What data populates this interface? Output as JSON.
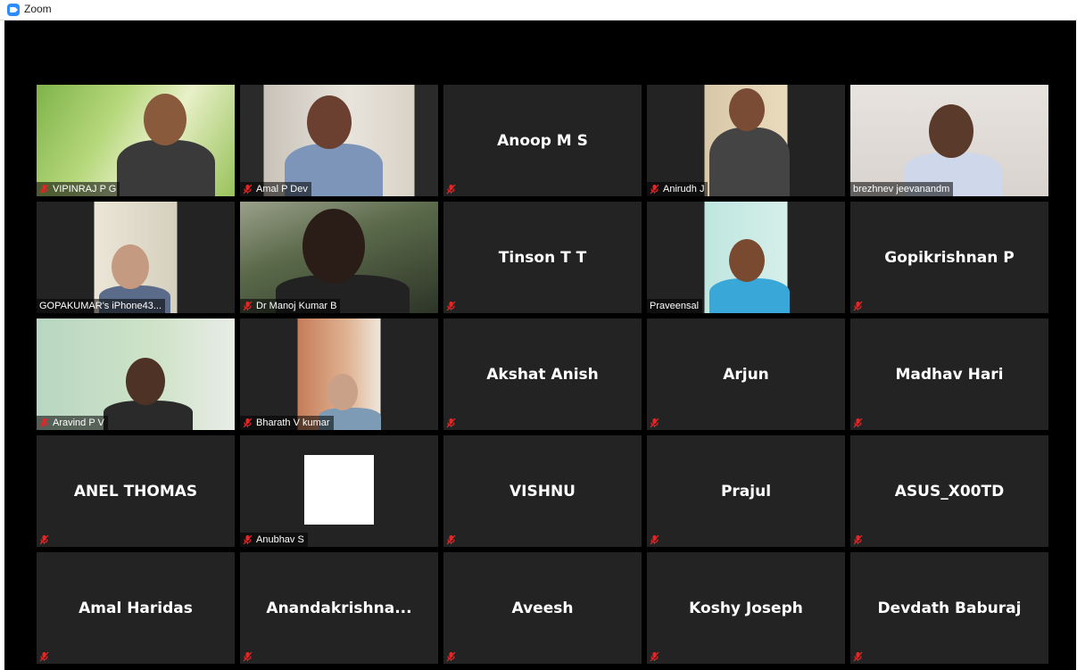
{
  "window": {
    "title": "Zoom"
  },
  "participants": [
    {
      "name": "VIPINRAJ P G",
      "video": true,
      "muted": true
    },
    {
      "name": "Amal P Dev",
      "video": true,
      "muted": true
    },
    {
      "name": "Anoop M S",
      "video": false,
      "muted": true
    },
    {
      "name": "Anirudh J",
      "video": true,
      "muted": true
    },
    {
      "name": "brezhnev jeevanandm",
      "video": true,
      "muted": false
    },
    {
      "name": "GOPAKUMAR's iPhone43...",
      "video": true,
      "muted": false
    },
    {
      "name": "Dr Manoj Kumar B",
      "video": true,
      "muted": true
    },
    {
      "name": "Tinson T T",
      "video": false,
      "muted": true
    },
    {
      "name": "Praveensal",
      "video": true,
      "muted": false,
      "speaking": true
    },
    {
      "name": "Gopikrishnan P",
      "video": false,
      "muted": true
    },
    {
      "name": "Aravind P V",
      "video": true,
      "muted": true
    },
    {
      "name": "Bharath V kumar",
      "video": true,
      "muted": true
    },
    {
      "name": "Akshat Anish",
      "video": false,
      "muted": true
    },
    {
      "name": "Arjun",
      "video": false,
      "muted": true
    },
    {
      "name": "Madhav Hari",
      "video": false,
      "muted": true
    },
    {
      "name": "ANEL THOMAS",
      "video": false,
      "muted": true
    },
    {
      "name": "Anubhav S",
      "video": true,
      "muted": true,
      "logo": true
    },
    {
      "name": "VISHNU",
      "video": false,
      "muted": true
    },
    {
      "name": "Prajul",
      "video": false,
      "muted": true
    },
    {
      "name": "ASUS_X00TD",
      "video": false,
      "muted": true
    },
    {
      "name": "Amal Haridas",
      "video": false,
      "muted": true
    },
    {
      "name": "Anandakrishna...",
      "video": false,
      "muted": true
    },
    {
      "name": "Aveesh",
      "video": false,
      "muted": true
    },
    {
      "name": "Koshy Joseph",
      "video": false,
      "muted": true
    },
    {
      "name": "Devdath Baburaj",
      "video": false,
      "muted": true
    }
  ],
  "colors": {
    "background": "#000000",
    "tile": "#232323",
    "speaking_border": "#e6e695",
    "muted_icon": "#e02828"
  },
  "icons": {
    "muted": "microphone-muted-icon",
    "app": "zoom-logo-icon"
  }
}
